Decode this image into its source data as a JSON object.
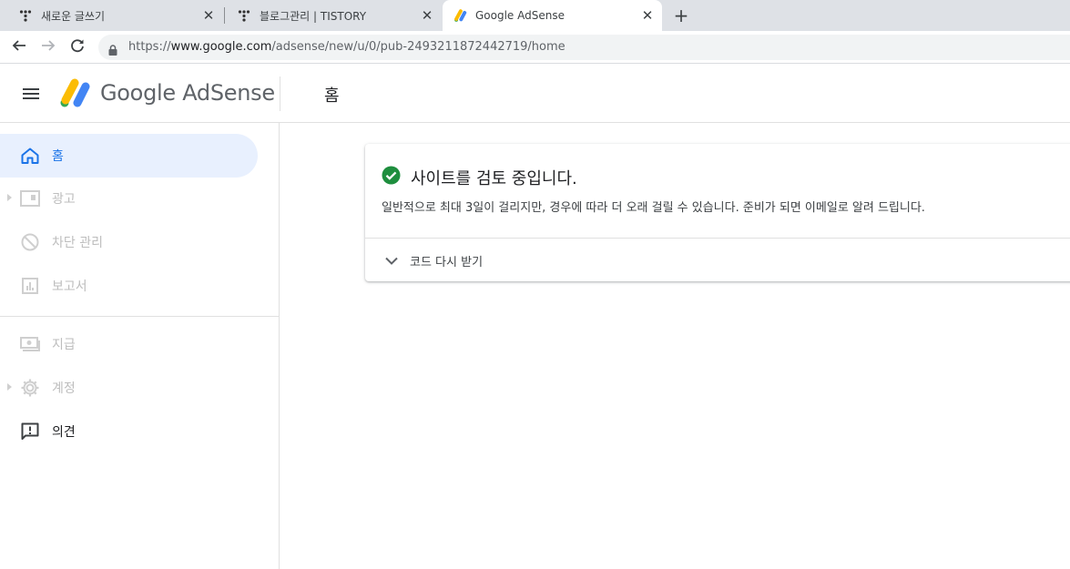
{
  "browser": {
    "tabs": [
      {
        "title": "새로운 글쓰기",
        "icon": "tistory-icon",
        "active": false
      },
      {
        "title": "블로그관리 | TISTORY",
        "icon": "tistory-icon",
        "active": false
      },
      {
        "title": "Google AdSense",
        "icon": "adsense-icon",
        "active": true
      }
    ],
    "close_glyph": "✕",
    "new_tab_glyph": "+",
    "url": {
      "prefix": "https://",
      "host": "www.google.com",
      "path": "/adsense/new/u/0/pub-2493211872442719/home"
    }
  },
  "appbar": {
    "brand_google": "Google",
    "brand_product": "AdSense",
    "page_title": "홈"
  },
  "sidebar": {
    "items": [
      {
        "label": "홈",
        "icon": "home-icon",
        "state": "active",
        "expandable": false
      },
      {
        "label": "광고",
        "icon": "ads-icon",
        "state": "disabled",
        "expandable": true
      },
      {
        "label": "차단 관리",
        "icon": "block-icon",
        "state": "disabled",
        "expandable": false
      },
      {
        "label": "보고서",
        "icon": "reports-icon",
        "state": "disabled",
        "expandable": false
      },
      {
        "label": "지급",
        "icon": "payments-icon",
        "state": "disabled",
        "expandable": false
      },
      {
        "label": "계정",
        "icon": "gear-icon",
        "state": "disabled",
        "expandable": true
      },
      {
        "label": "의견",
        "icon": "feedback-icon",
        "state": "enabled",
        "expandable": false
      }
    ]
  },
  "status_card": {
    "icon": "check-circle-icon",
    "heading": "사이트를 검토 중입니다.",
    "description": "일반적으로 최대 3일이 걸리지만, 경우에 따라 더 오래 걸릴 수 있습니다. 준비가 되면 이메일로 알려 드립니다.",
    "expand_label": "코드 다시 받기"
  },
  "colors": {
    "accent": "#1a73e8",
    "active_nav_bg": "#e8f0fe",
    "success": "#1e8e3e",
    "disabled_text": "#bdbdbd",
    "tab_strip": "#dee1e6"
  }
}
